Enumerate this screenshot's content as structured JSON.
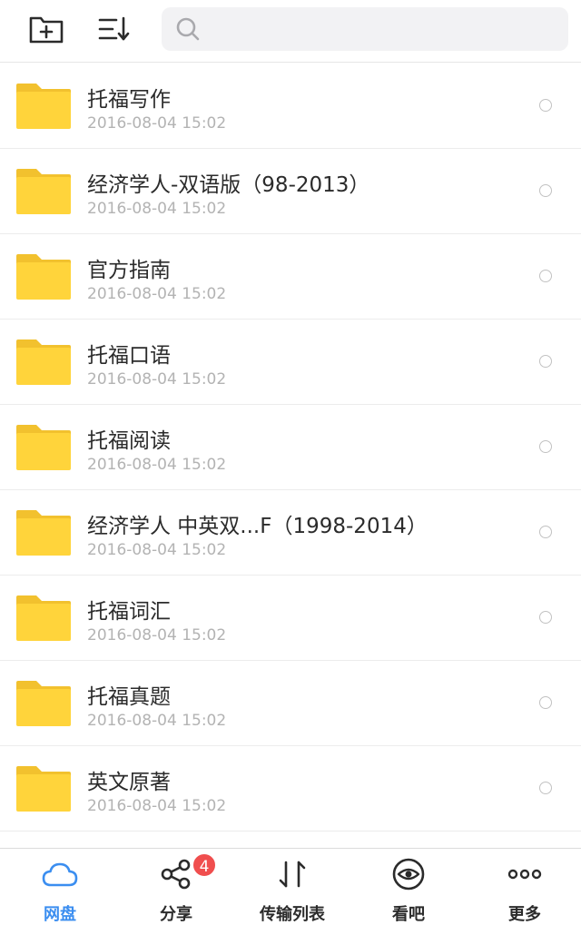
{
  "search": {
    "placeholder": "",
    "value": ""
  },
  "files": [
    {
      "name": "托福写作",
      "date": "2016-08-04 15:02"
    },
    {
      "name": "经济学人-双语版（98-2013）",
      "date": "2016-08-04 15:02"
    },
    {
      "name": "官方指南",
      "date": "2016-08-04 15:02"
    },
    {
      "name": "托福口语",
      "date": "2016-08-04 15:02"
    },
    {
      "name": "托福阅读",
      "date": "2016-08-04 15:02"
    },
    {
      "name": "经济学人  中英双...F（1998-2014）",
      "date": "2016-08-04 15:02"
    },
    {
      "name": "托福词汇",
      "date": "2016-08-04 15:02"
    },
    {
      "name": "托福真题",
      "date": "2016-08-04 15:02"
    },
    {
      "name": "英文原著",
      "date": "2016-08-04 15:02"
    }
  ],
  "tabs": [
    {
      "label": "网盘",
      "icon": "cloud-icon",
      "active": true
    },
    {
      "label": "分享",
      "icon": "share-icon",
      "badge": "4"
    },
    {
      "label": "传输列表",
      "icon": "transfer-icon"
    },
    {
      "label": "看吧",
      "icon": "eye-icon"
    },
    {
      "label": "更多",
      "icon": "more-icon"
    }
  ],
  "colors": {
    "accent": "#3b8ef0",
    "folder": "#ffd43b",
    "badge": "#f04e4e",
    "date_text": "#b3b3b3"
  }
}
